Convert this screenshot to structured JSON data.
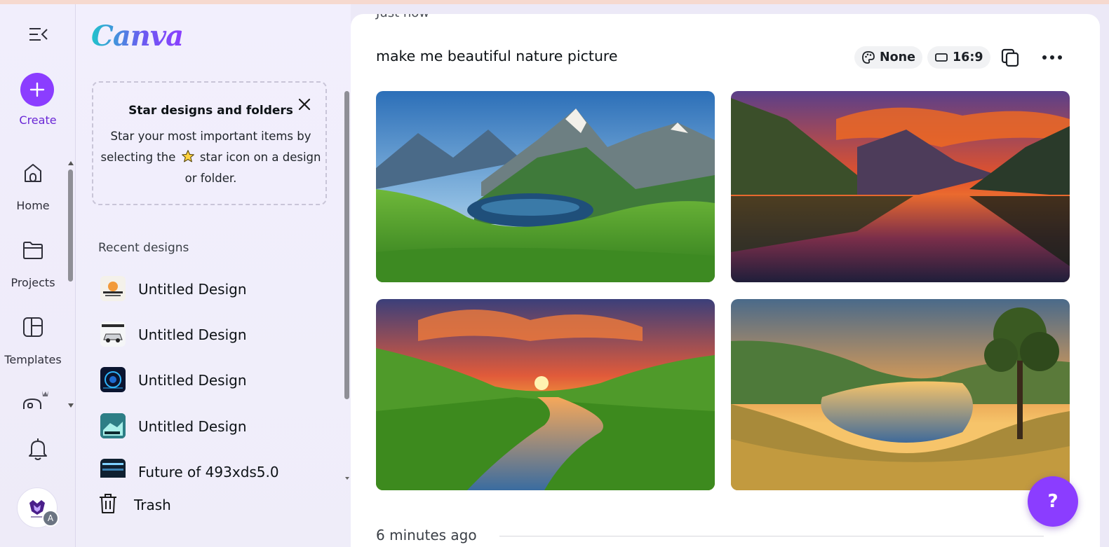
{
  "rail": {
    "create_label": "Create",
    "items": [
      {
        "label": "Home",
        "icon": "home-icon"
      },
      {
        "label": "Projects",
        "icon": "folder-icon"
      },
      {
        "label": "Templates",
        "icon": "templates-icon"
      }
    ],
    "avatar_badge": "A"
  },
  "panel": {
    "logo": "Canva",
    "tip": {
      "title": "Star designs and folders",
      "body_before": "Star your most important items by selecting the",
      "body_after": "star icon on a design or folder."
    },
    "recent_heading": "Recent designs",
    "designs": [
      {
        "name": "Untitled Design"
      },
      {
        "name": "Untitled Design"
      },
      {
        "name": "Untitled Design"
      },
      {
        "name": "Untitled Design"
      },
      {
        "name": "Future of 493xds5.0"
      }
    ],
    "trash_label": "Trash"
  },
  "main": {
    "timestamp_top": "Just now",
    "prompt": "make me beautiful nature picture",
    "style_chip": "None",
    "ratio_chip": "16:9",
    "timestamp_bottom": "6 minutes ago"
  },
  "help_label": "?",
  "colors": {
    "accent": "#8b3dff",
    "rail_bg": "#f1eefc",
    "card_bg": "#ffffff"
  }
}
